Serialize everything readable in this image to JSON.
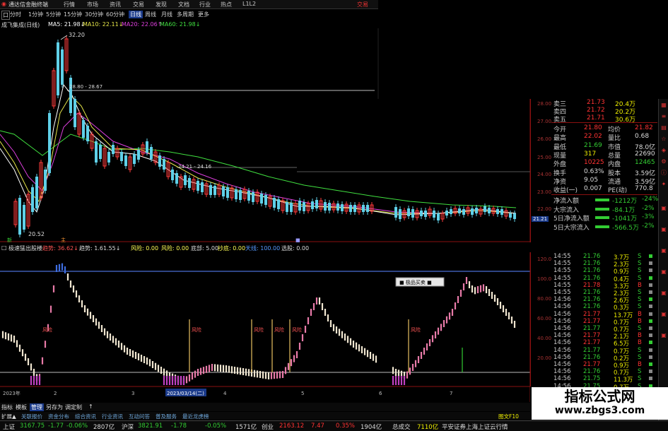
{
  "app": {
    "title": "通达信金融终端",
    "menus": [
      "行情",
      "市场",
      "资讯",
      "交易",
      "发现",
      "文档",
      "行业",
      "热点",
      "L1L2"
    ],
    "trade_button": "交易"
  },
  "periods": {
    "items": [
      "分时",
      "1分钟",
      "5分钟",
      "15分钟",
      "30分钟",
      "60分钟",
      "日线",
      "周线",
      "月线",
      "多周期",
      "更多"
    ],
    "selected": "日线",
    "icon": "口"
  },
  "ma_legend": {
    "title": "成飞集成(日线)",
    "ma5": "MA5: 21.98↓",
    "ma10": "MA10: 22.11↓",
    "ma20": "MA20: 22.06↑",
    "ma60": "MA60: 21.98↓"
  },
  "main_chart": {
    "high_label": "32.20",
    "low_label": "20.52",
    "range_label_1": "28.80 - 28.67",
    "range_label_2": "24.21 - 24.16",
    "current_price": "21.21",
    "y_ticks": [
      "28.00",
      "27.00",
      "26.00",
      "25.00",
      "24.00",
      "23.00",
      "22.00"
    ],
    "marker_1": "新",
    "marker_2": "主",
    "marker_3": "■"
  },
  "indicator_bar": {
    "name": "极速猛出股楼",
    "items": [
      {
        "label": "趋势: 36.62↓",
        "color": "#ff5555"
      },
      {
        "label": "趋势: 1.61.55↓",
        "color": "#dddddd"
      },
      {
        "label": "风险: 0.00",
        "color": "#ffff55"
      },
      {
        "label": "风险: 0.00",
        "color": "#ffff55"
      },
      {
        "label": "底部: 5.00",
        "color": "#dddddd"
      },
      {
        "label": "抄底: 0.00",
        "color": "#ffff55"
      },
      {
        "label": "天线: 100.00",
        "color": "#5599ff"
      },
      {
        "label": "选股: 0.00",
        "color": "#dddddd"
      }
    ]
  },
  "sub_chart": {
    "y_ticks": [
      "120.0",
      "100.0",
      "80.00",
      "60.00",
      "40.00",
      "20.00"
    ],
    "popup": "■ 极品买卖 ■",
    "signal_labels": [
      "风险",
      "风险",
      "风险",
      "风险",
      "风险",
      "风险"
    ],
    "date_labels": [
      "2023年",
      "2",
      "3",
      "2023/03/14(二)",
      "4",
      "5",
      "6",
      "7"
    ]
  },
  "quote": {
    "asks": [
      {
        "label": "卖三",
        "price": "21.73",
        "vol": "20.4万"
      },
      {
        "label": "卖四",
        "price": "21.72",
        "vol": "20.2万"
      },
      {
        "label": "卖五",
        "price": "21.71",
        "vol": "30.6万"
      }
    ],
    "stats": [
      {
        "l1": "今开",
        "v1": "21.80",
        "l2": "均价",
        "v2": "21.82"
      },
      {
        "l1": "最高",
        "v1": "22.02",
        "l2": "量比",
        "v2": "0.68"
      },
      {
        "l1": "最低",
        "v1": "21.69",
        "l2": "市值",
        "v2": "78.0亿"
      },
      {
        "l1": "现量",
        "v1": "317",
        "l2": "总量",
        "v2": "22690"
      },
      {
        "l1": "外盘",
        "v1": "10225",
        "l2": "内盘",
        "v2": "12465"
      },
      {
        "l1": "换手",
        "v1": "0.63%",
        "l2": "股本",
        "v2": "3.59亿"
      },
      {
        "l1": "净资",
        "v1": "9.05",
        "l2": "流通",
        "v2": "3.59亿"
      },
      {
        "l1": "收益(一)",
        "v1": "0.007",
        "l2": "PE(动)",
        "v2": "770.8"
      }
    ],
    "flows": [
      {
        "label": "净流入额",
        "value": "-1212万",
        "pct": "-24%"
      },
      {
        "label": "大宗流入",
        "value": "-84.1万",
        "pct": "-2%"
      },
      {
        "label": "5日净流入额",
        "value": "-1041万",
        "pct": "-3%"
      },
      {
        "label": "5日大宗流入",
        "value": "-566.5万",
        "pct": "-2%"
      }
    ]
  },
  "ticks": [
    {
      "time": "14:55",
      "price": "21.76",
      "vol": "3.7万",
      "side": "S"
    },
    {
      "time": "14:55",
      "price": "21.76",
      "vol": "2.3万",
      "side": "S"
    },
    {
      "time": "14:55",
      "price": "21.76",
      "vol": "0.9万",
      "side": "S"
    },
    {
      "time": "14:55",
      "price": "21.76",
      "vol": "0.4万",
      "side": "S"
    },
    {
      "time": "14:55",
      "price": "21.78",
      "vol": "3.3万",
      "side": "B"
    },
    {
      "time": "14:55",
      "price": "21.76",
      "vol": "2.3万",
      "side": "S"
    },
    {
      "time": "14:56",
      "price": "21.76",
      "vol": "2.6万",
      "side": "S"
    },
    {
      "time": "14:56",
      "price": "21.76",
      "vol": "0.3万",
      "side": "S"
    },
    {
      "time": "14:56",
      "price": "21.77",
      "vol": "13.7万",
      "side": "B"
    },
    {
      "time": "14:56",
      "price": "21.77",
      "vol": "0.7万",
      "side": "B"
    },
    {
      "time": "14:56",
      "price": "21.77",
      "vol": "0.7万",
      "side": "S"
    },
    {
      "time": "14:56",
      "price": "21.77",
      "vol": "2.1万",
      "side": "B"
    },
    {
      "time": "14:56",
      "price": "21.77",
      "vol": "6.5万",
      "side": "B"
    },
    {
      "time": "14:56",
      "price": "21.77",
      "vol": "0.7万",
      "side": "S"
    },
    {
      "time": "14:56",
      "price": "21.76",
      "vol": "0.2万",
      "side": "S"
    },
    {
      "time": "14:56",
      "price": "21.77",
      "vol": "0.9万",
      "side": "B"
    },
    {
      "time": "14:56",
      "price": "21.76",
      "vol": "0.7万",
      "side": "S"
    },
    {
      "time": "14:56",
      "price": "21.75",
      "vol": "11.3万",
      "side": "S"
    },
    {
      "time": "14:56",
      "price": "21.75",
      "vol": "0.7万",
      "side": "S"
    }
  ],
  "bottom_tabs": [
    "指标",
    "模板",
    "管理",
    "另存为",
    "调定制",
    "↑"
  ],
  "bottom_subtabs": [
    "扩展▲",
    "关联报价",
    "资金分布",
    "综合资讯",
    "行业资讯",
    "互动问答",
    "普及服务",
    "最近龙虎榜"
  ],
  "bottom_right_label": "图文F10",
  "status": {
    "sh_label": "上证",
    "sh_value": "3167.75",
    "sh_change": "-1.77",
    "sh_pct": "-0.06%",
    "sh_amount": "2807亿",
    "hs_label": "沪深",
    "hs_value": "3821.91",
    "hs_change": "-1.78",
    "hs_pct": "-0.05%",
    "hs_amount": "1571亿",
    "cy_label": "创业",
    "cy_value": "2163.12",
    "cy_change": "7.47",
    "cy_pct": "0.35%",
    "cy_amount": "1904亿",
    "total_label": "总成交",
    "total_value": "7110亿",
    "broker": "平安证券上海上证云行情"
  },
  "watermark": {
    "title": "指标公式网",
    "url": "www.zbgs3.com"
  }
}
